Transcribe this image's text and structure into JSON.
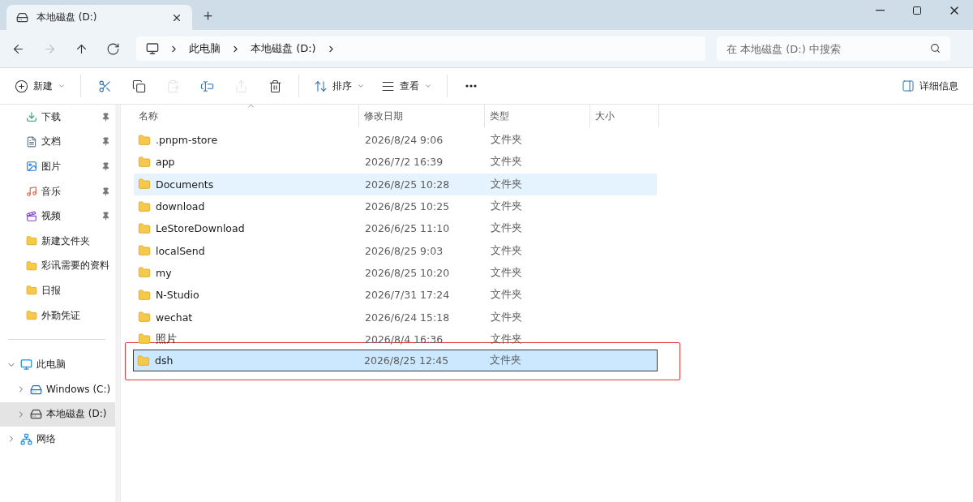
{
  "tab": {
    "title": "本地磁盘 (D:)"
  },
  "address": {
    "path": [
      "此电脑",
      "本地磁盘 (D:)"
    ]
  },
  "search": {
    "placeholder": "在 本地磁盘 (D:) 中搜索"
  },
  "nav": [
    {
      "kind": "back",
      "disabled": false
    },
    {
      "kind": "forward",
      "disabled": true
    },
    {
      "kind": "up",
      "disabled": false
    },
    {
      "kind": "refresh",
      "disabled": false
    }
  ],
  "toolbar": [
    {
      "kind": "new",
      "label": "新建",
      "disabled": false
    },
    {
      "kind": "cut",
      "disabled": false
    },
    {
      "kind": "copy",
      "disabled": false
    },
    {
      "kind": "paste",
      "disabled": true
    },
    {
      "kind": "rename",
      "disabled": false
    },
    {
      "kind": "share",
      "disabled": true
    },
    {
      "kind": "delete",
      "disabled": false
    },
    {
      "kind": "sort",
      "label": "排序",
      "disabled": false
    },
    {
      "kind": "view",
      "label": "查看",
      "disabled": false
    },
    {
      "kind": "more",
      "disabled": false
    }
  ],
  "details_button": {
    "label": "详细信息"
  },
  "quick_access": [
    {
      "kind": "downloads",
      "label": "下载",
      "pinned": true
    },
    {
      "kind": "documents",
      "label": "文档",
      "pinned": true
    },
    {
      "kind": "pictures",
      "label": "图片",
      "pinned": true
    },
    {
      "kind": "music",
      "label": "音乐",
      "pinned": true
    },
    {
      "kind": "videos",
      "label": "视频",
      "pinned": true
    },
    {
      "kind": "folder",
      "label": "新建文件夹",
      "pinned": false
    },
    {
      "kind": "folder",
      "label": "彩讯需要的资料",
      "pinned": false
    },
    {
      "kind": "folder",
      "label": "日报",
      "pinned": false
    },
    {
      "kind": "folder",
      "label": "外勤凭证",
      "pinned": false
    }
  ],
  "tree": [
    {
      "kind": "pc",
      "label": "此电脑",
      "expanded": true,
      "selected": false,
      "children": [
        {
          "kind": "drive-c",
          "label": "Windows (C:)",
          "expanded": false,
          "selected": false
        },
        {
          "kind": "drive-d",
          "label": "本地磁盘 (D:)",
          "expanded": false,
          "selected": true
        }
      ]
    },
    {
      "kind": "network",
      "label": "网络",
      "expanded": false,
      "selected": false
    }
  ],
  "columns": [
    {
      "label": "名称",
      "sorted": true
    },
    {
      "label": "修改日期",
      "sorted": false
    },
    {
      "label": "类型",
      "sorted": false
    },
    {
      "label": "大小",
      "sorted": false
    }
  ],
  "rows": [
    {
      "name": ".pnpm-store",
      "date": "2026/8/24 9:06",
      "type": "文件夹",
      "hovered": false,
      "selected": false,
      "annotated": false
    },
    {
      "name": "app",
      "date": "2026/7/2 16:39",
      "type": "文件夹",
      "hovered": false,
      "selected": false,
      "annotated": false
    },
    {
      "name": "Documents",
      "date": "2026/8/25 10:28",
      "type": "文件夹",
      "hovered": true,
      "selected": false,
      "annotated": false
    },
    {
      "name": "download",
      "date": "2026/8/25 10:25",
      "type": "文件夹",
      "hovered": false,
      "selected": false,
      "annotated": false
    },
    {
      "name": "LeStoreDownload",
      "date": "2026/6/25 11:10",
      "type": "文件夹",
      "hovered": false,
      "selected": false,
      "annotated": false
    },
    {
      "name": "localSend",
      "date": "2026/8/25 9:03",
      "type": "文件夹",
      "hovered": false,
      "selected": false,
      "annotated": false
    },
    {
      "name": "my",
      "date": "2026/8/25 10:20",
      "type": "文件夹",
      "hovered": false,
      "selected": false,
      "annotated": false
    },
    {
      "name": "N-Studio",
      "date": "2026/7/31 17:24",
      "type": "文件夹",
      "hovered": false,
      "selected": false,
      "annotated": false
    },
    {
      "name": "wechat",
      "date": "2026/6/24 15:18",
      "type": "文件夹",
      "hovered": false,
      "selected": false,
      "annotated": false
    },
    {
      "name": "照片",
      "date": "2026/8/4 16:36",
      "type": "文件夹",
      "hovered": false,
      "selected": false,
      "annotated": false
    },
    {
      "name": "dsh",
      "date": "2026/8/25 12:45",
      "type": "文件夹",
      "hovered": false,
      "selected": true,
      "annotated": true
    }
  ]
}
